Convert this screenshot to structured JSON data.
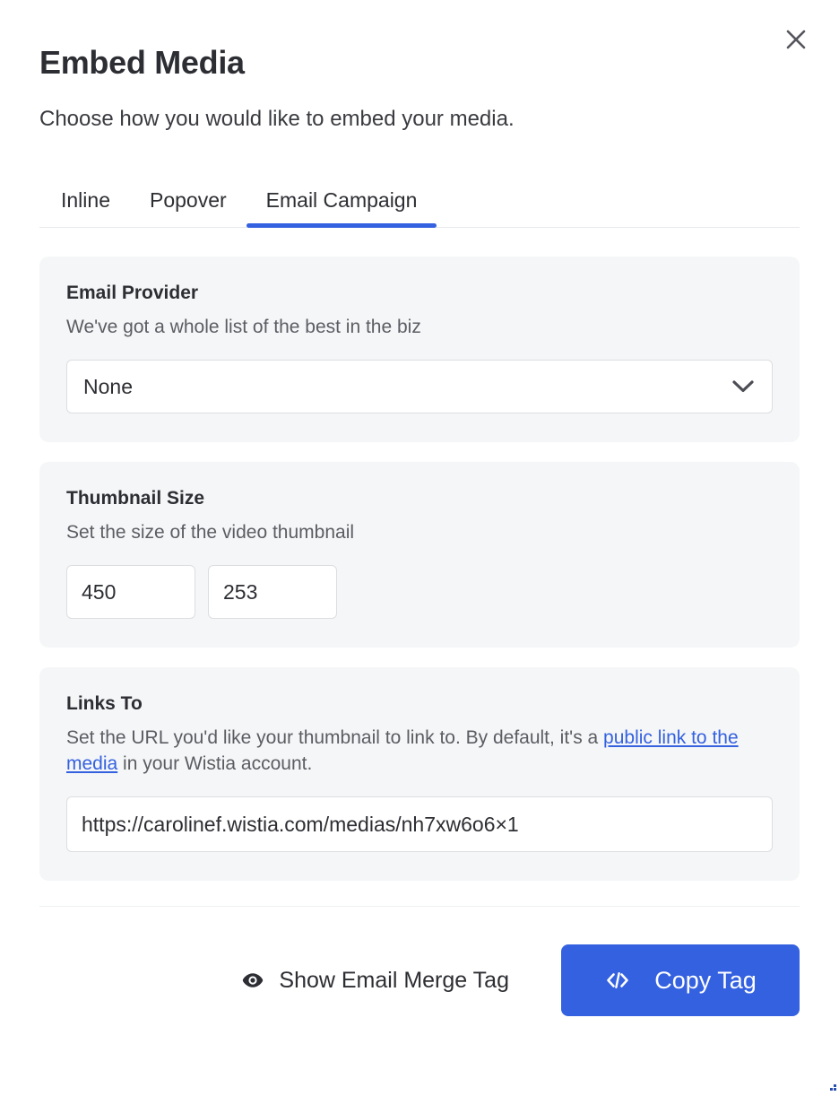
{
  "dialog": {
    "title": "Embed Media",
    "subtitle": "Choose how you would like to embed your media.",
    "close_label": "×",
    "close_icon": "close-icon"
  },
  "tabs": [
    {
      "label": "Inline",
      "active": false
    },
    {
      "label": "Popover",
      "active": false
    },
    {
      "label": "Email Campaign",
      "active": true
    }
  ],
  "sections": {
    "email_provider": {
      "title": "Email Provider",
      "description": "We've got a whole list of the best in the biz",
      "select_value": "None",
      "chevron_icon": "chevron-down-icon"
    },
    "thumbnail_size": {
      "title": "Thumbnail Size",
      "description": "Set the size of the video thumbnail",
      "width_value": "450",
      "height_value": "253"
    },
    "links_to": {
      "title": "Links To",
      "description_before": "Set the URL you'd like your thumbnail to link to. By default, it's a ",
      "link_text": "public link to the media",
      "description_after": " in your Wistia account.",
      "url_value": "https://carolinef.wistia.com/medias/nh7xw6o6×1"
    }
  },
  "footer": {
    "show_merge_tag_label": "Show Email Merge Tag",
    "show_merge_tag_icon": "eye-icon",
    "copy_tag_label": "Copy Tag",
    "copy_tag_icon": "code-icon"
  },
  "colors": {
    "accent": "#3461e0",
    "card_bg": "#f5f6f7",
    "text": "#2d2e33",
    "muted_text": "#5b5d63",
    "border": "#dcdee1"
  }
}
